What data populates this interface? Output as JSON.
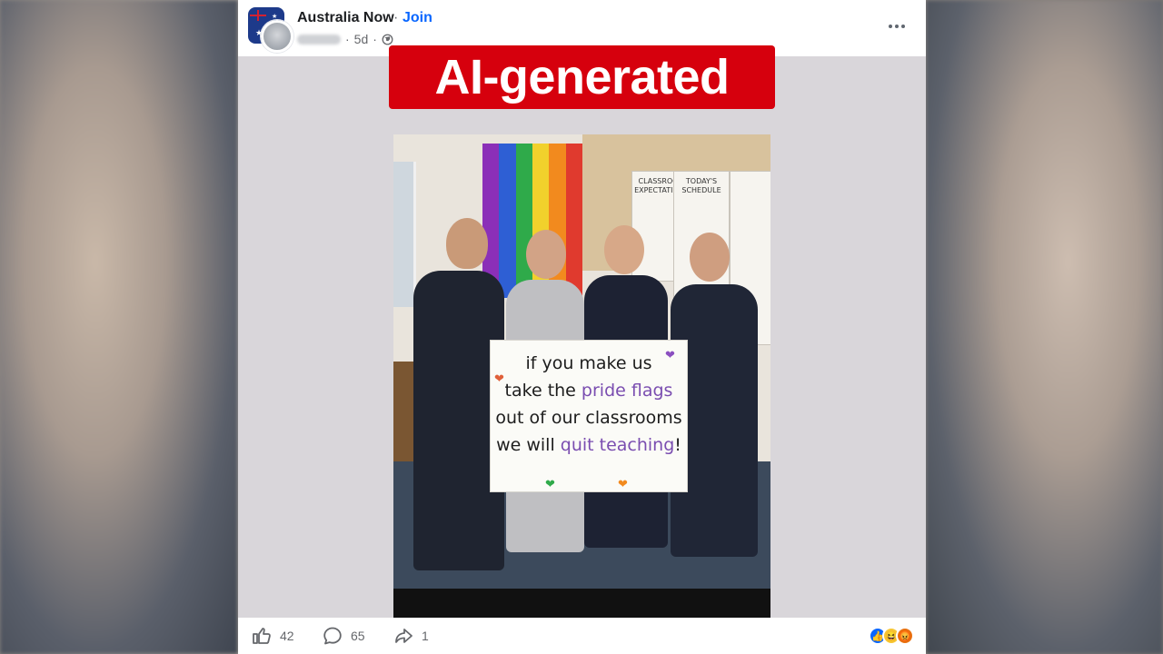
{
  "post": {
    "page_name": "Australia Now",
    "join_label": "Join",
    "separator": "·",
    "time_ago": "5d",
    "badge_text": "AI-generated",
    "sign": {
      "line1": "if you make us",
      "line2_a": "take the ",
      "line2_b": "pride flags",
      "line3": "out of our classrooms",
      "line4_a": "we will ",
      "line4_b": "quit teaching",
      "line4_c": "!"
    },
    "board": {
      "expectations": "CLASSROOM EXPECTATIONS",
      "schedule": "TODAY'S SCHEDULE"
    }
  },
  "footer": {
    "like_count": "42",
    "comment_count": "65",
    "share_count": "1"
  },
  "icons": {
    "like": "thumbs-up-icon",
    "comment": "comment-icon",
    "share": "share-icon",
    "more": "more-icon",
    "globe": "globe-icon"
  },
  "colors": {
    "badge": "#d6000d",
    "link": "#0866ff",
    "muted": "#65676b"
  }
}
